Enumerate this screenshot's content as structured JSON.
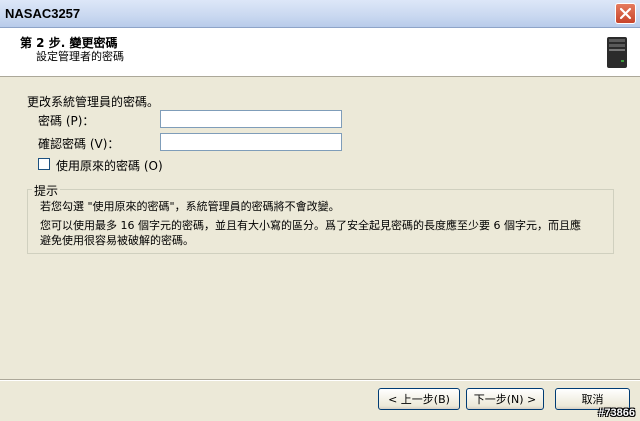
{
  "window": {
    "title": "NASAC3257"
  },
  "header": {
    "step": "第 2 步. 變更密碼",
    "subtitle": "設定管理者的密碼"
  },
  "form": {
    "intro": "更改系統管理員的密碼。",
    "password_label": "密碼 (P)：",
    "password_value": "",
    "confirm_label": "確認密碼 (V)：",
    "confirm_value": "",
    "keep_label": "使用原來的密碼 (O)",
    "keep_checked": false
  },
  "hint": {
    "title": "提示",
    "line1": "若您勾選 \"使用原來的密碼\"，系統管理員的密碼將不會改變。",
    "line2": "您可以使用最多 16 個字元的密碼，並且有大小寫的區分。爲了安全起見密碼的長度應至少要 6 個字元，而且應",
    "line3": "避免使用很容易被破解的密碼。"
  },
  "buttons": {
    "back": "< 上一步(B)",
    "next": "下一步(N) >",
    "cancel": "取消"
  },
  "watermark": "#73866",
  "colors": {
    "title_bar": "#c9d8f0",
    "close_button": "#c8442a",
    "dialog_bg": "#ece9d8"
  }
}
